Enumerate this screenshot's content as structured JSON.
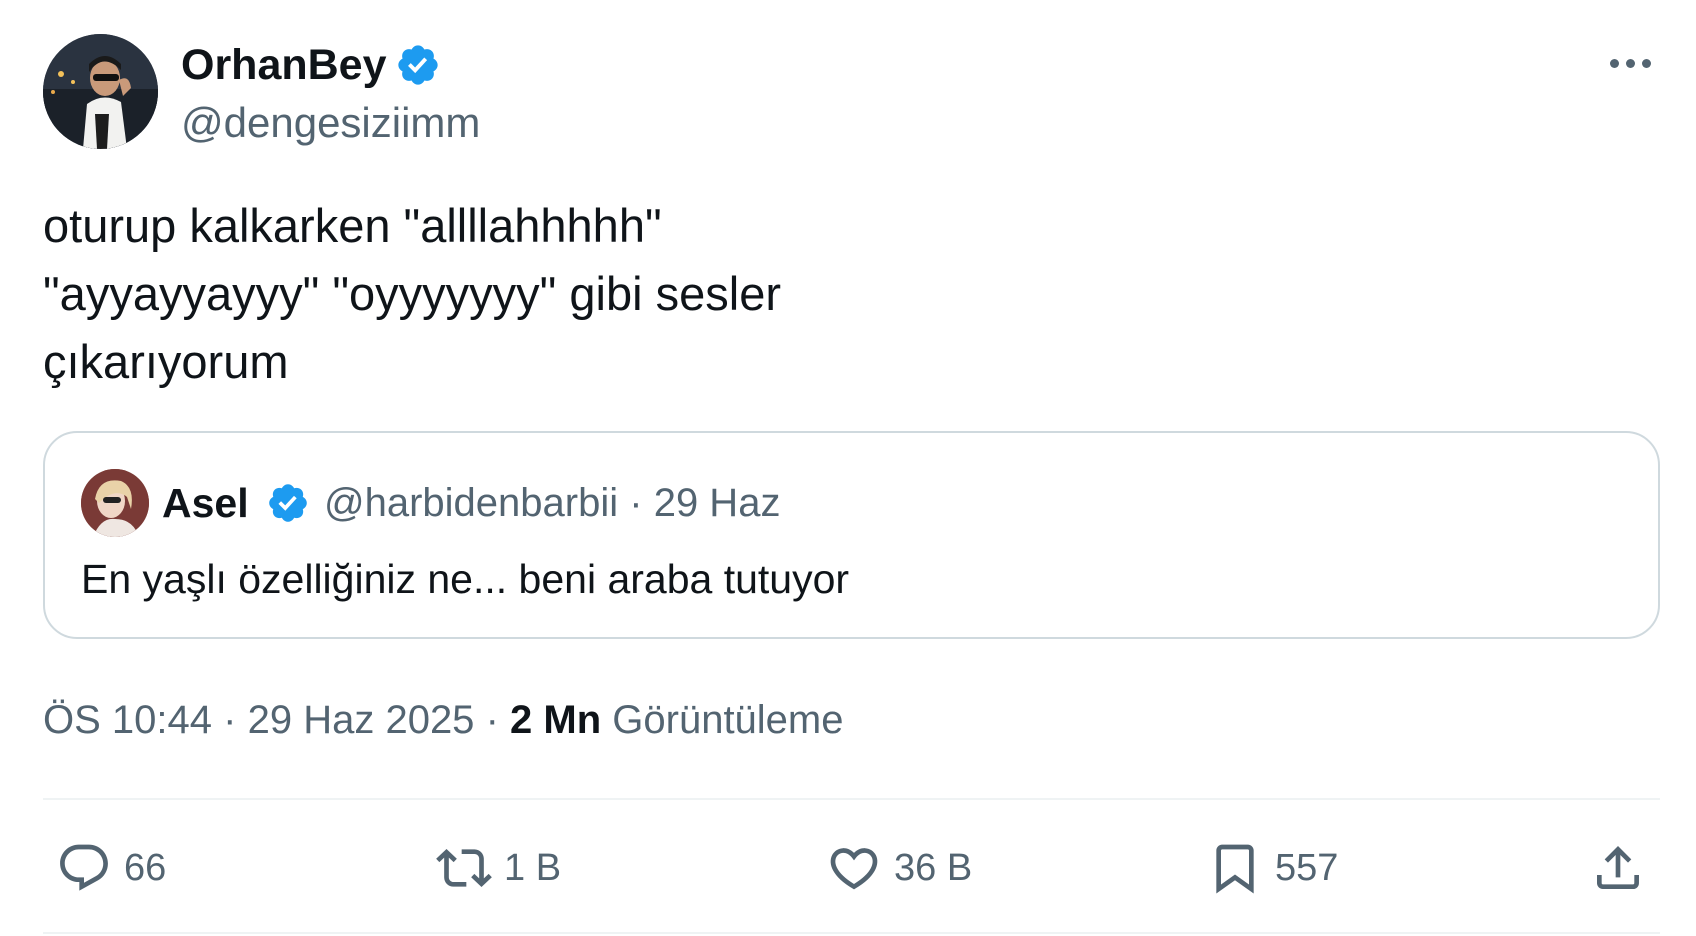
{
  "author": {
    "name": "OrhanBey",
    "handle": "@dengesiziimm",
    "verified": true
  },
  "tweet": {
    "lines": [
      "oturup kalkarken \"allllahhhhh\"",
      "\"ayyayyayyy\" \"oyyyyyyy\" gibi sesler",
      "çıkarıyorum"
    ]
  },
  "quote": {
    "name": "Asel",
    "handle": "@harbidenbarbii",
    "date": "29 Haz",
    "separator": "·",
    "text": "En yaşlı özelliğiniz ne... beni araba tutuyor"
  },
  "meta": {
    "time": "ÖS 10:44",
    "date": "29 Haz 2025",
    "separator": "·",
    "views_count": "2 Mn",
    "views_label": "Görüntüleme"
  },
  "actions": {
    "replies": "66",
    "retweets": "1 B",
    "likes": "36 B",
    "bookmarks": "557"
  },
  "colors": {
    "verified": "#1d9bf0",
    "secondary_text": "#536471",
    "primary_text": "#0f1419",
    "border": "#cfd9de"
  },
  "icons": [
    "verified-badge-icon",
    "more-icon",
    "reply-icon",
    "retweet-icon",
    "like-icon",
    "bookmark-icon",
    "share-icon"
  ]
}
